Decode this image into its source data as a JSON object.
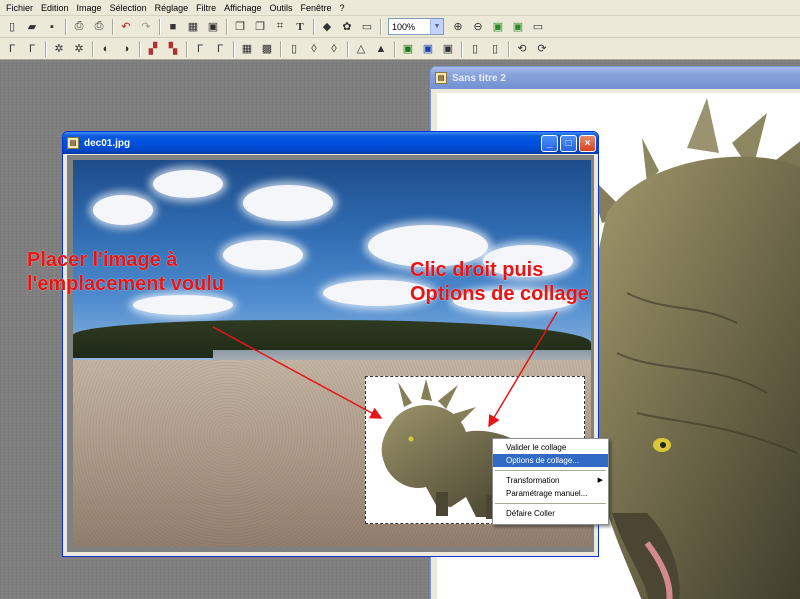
{
  "menubar": {
    "items": [
      "Fichier",
      "Edition",
      "Image",
      "Sélection",
      "Réglage",
      "Filtre",
      "Affichage",
      "Outils",
      "Fenêtre",
      "?"
    ]
  },
  "toolbar": {
    "zoom_value": "100%"
  },
  "windows": {
    "back": {
      "title": "Sans titre 2"
    },
    "front": {
      "title": "dec01.jpg"
    }
  },
  "annotations": {
    "left_line1": "Placer l'image à",
    "left_line2": "l'emplacement voulu",
    "right_line1": "Clic droit puis",
    "right_line2": "Options de collage"
  },
  "context_menu": {
    "items": [
      "Valider le collage",
      "Options de collage...",
      "Transformation",
      "Paramétrage manuel...",
      "Défaire Coller"
    ],
    "highlighted_index": 1
  },
  "colors": {
    "annotation": "#e81414",
    "highlight": "#316ac5",
    "title_active": "#0050e0"
  }
}
